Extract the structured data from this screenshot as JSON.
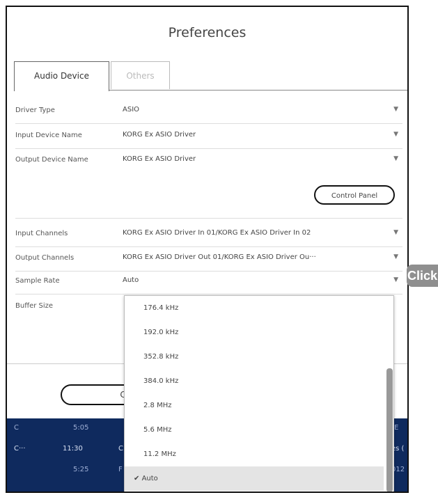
{
  "dialog": {
    "title": "Preferences"
  },
  "tabs": [
    {
      "label": "Audio Device",
      "active": true
    },
    {
      "label": "Others",
      "active": false
    }
  ],
  "settings": {
    "driver_type": {
      "label": "Driver Type",
      "value": "ASIO"
    },
    "input_device": {
      "label": "Input Device Name",
      "value": "KORG Ex ASIO Driver"
    },
    "output_device": {
      "label": "Output Device Name",
      "value": "KORG Ex ASIO Driver"
    },
    "control_panel_label": "Control Panel",
    "input_channels": {
      "label": "Input Channels",
      "value": "KORG Ex ASIO Driver In 01/KORG Ex ASIO Driver In 02"
    },
    "output_channels": {
      "label": "Output Channels",
      "value": "KORG Ex ASIO Driver Out 01/KORG Ex ASIO Driver Ou···"
    },
    "sample_rate": {
      "label": "Sample Rate",
      "value": "Auto"
    },
    "buffer_size": {
      "label": "Buffer Size"
    }
  },
  "dropdown_arrow": "▼",
  "cancel_label": "CA",
  "sample_rate_options": [
    "176.4 kHz",
    "192.0 kHz",
    "352.8 kHz",
    "384.0 kHz",
    "2.8 MHz",
    "5.6 MHz",
    "11.2 MHz",
    "Auto"
  ],
  "selected_option": "Auto",
  "checkmark": "✔",
  "background_list": {
    "row1": [
      "C",
      "5:05",
      "E"
    ],
    "row2": [
      "C···",
      "11:30",
      "C",
      "es ("
    ],
    "row3": [
      "5:25",
      "F",
      "012"
    ]
  },
  "annotation": "Click"
}
